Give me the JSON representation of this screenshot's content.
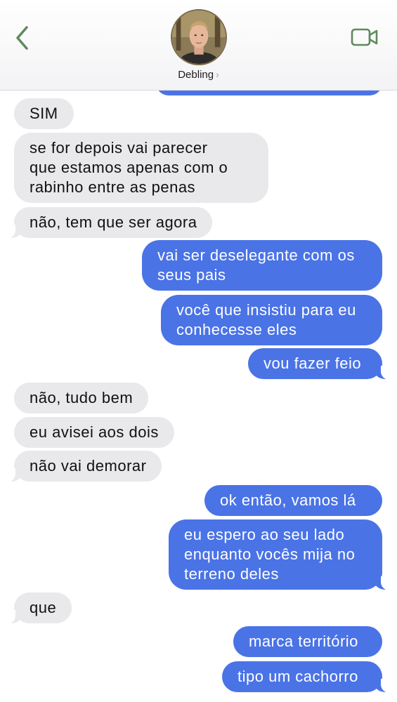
{
  "header": {
    "contact_name": "Debling",
    "name_chevron": "›"
  },
  "colors": {
    "incoming_bubble": "#e9e9eb",
    "outgoing_bubble": "#4a73e6",
    "accent_green": "#5f8a5c"
  },
  "icons": {
    "back": "chevron-left-icon",
    "video": "video-camera-icon"
  },
  "messages": [
    {
      "direction": "in",
      "text": "SIM"
    },
    {
      "direction": "in",
      "text": "se for depois vai parecer\nque estamos apenas com o\nrabinho entre as penas"
    },
    {
      "direction": "in",
      "text": "não, tem que ser agora"
    },
    {
      "direction": "out",
      "text": "vai ser deselegante com os\nseus pais"
    },
    {
      "direction": "out",
      "text": "você que insistiu para eu\nconhecesse eles"
    },
    {
      "direction": "out",
      "text": "vou fazer feio"
    },
    {
      "direction": "in",
      "text": "não, tudo bem"
    },
    {
      "direction": "in",
      "text": "eu avisei aos dois"
    },
    {
      "direction": "in",
      "text": "não vai demorar"
    },
    {
      "direction": "out",
      "text": "ok então, vamos lá"
    },
    {
      "direction": "out",
      "text": "eu espero ao seu lado\nenquanto vocês mija no\nterreno deles"
    },
    {
      "direction": "in",
      "text": "que"
    },
    {
      "direction": "out",
      "text": "marca território"
    },
    {
      "direction": "out",
      "text": "tipo um cachorro"
    }
  ]
}
